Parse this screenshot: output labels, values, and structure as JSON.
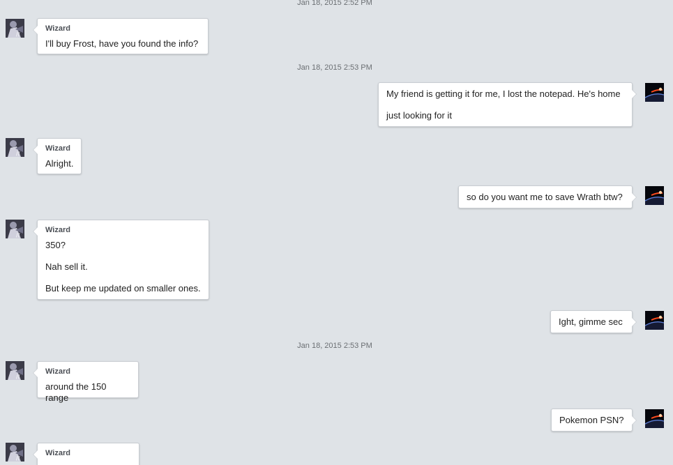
{
  "colors": {
    "background": "#dfe3e7",
    "bubble": "#ffffff",
    "timestamp": "#6b6f73",
    "sender": "#4b4f55"
  },
  "avatars": {
    "wizard": "wizard-avatar",
    "self": "space-planet-avatar"
  },
  "timestamps": [
    "Jan 18, 2015 2:52 PM",
    "Jan 18, 2015 2:53 PM",
    "Jan 18, 2015 2:53 PM"
  ],
  "messages": [
    {
      "side": "left",
      "sender": "Wizard",
      "lines": [
        "I'll buy Frost, have you found the info?"
      ]
    },
    {
      "side": "right",
      "lines": [
        "My friend is getting it for me, I lost the notepad. He's home",
        "just looking for it"
      ]
    },
    {
      "side": "left",
      "sender": "Wizard",
      "lines": [
        "Alright."
      ]
    },
    {
      "side": "right",
      "lines": [
        "so do you want me to save Wrath btw?"
      ]
    },
    {
      "side": "left",
      "sender": "Wizard",
      "lines": [
        "350?",
        "Nah sell it.",
        "But keep me updated on smaller ones."
      ]
    },
    {
      "side": "right",
      "lines": [
        "Ight, gimme sec"
      ]
    },
    {
      "side": "left",
      "sender": "Wizard",
      "lines": [
        "around the 150 range"
      ]
    },
    {
      "side": "right",
      "lines": [
        "Pokemon PSN?"
      ]
    },
    {
      "side": "left",
      "sender": "Wizard",
      "lines": []
    }
  ]
}
